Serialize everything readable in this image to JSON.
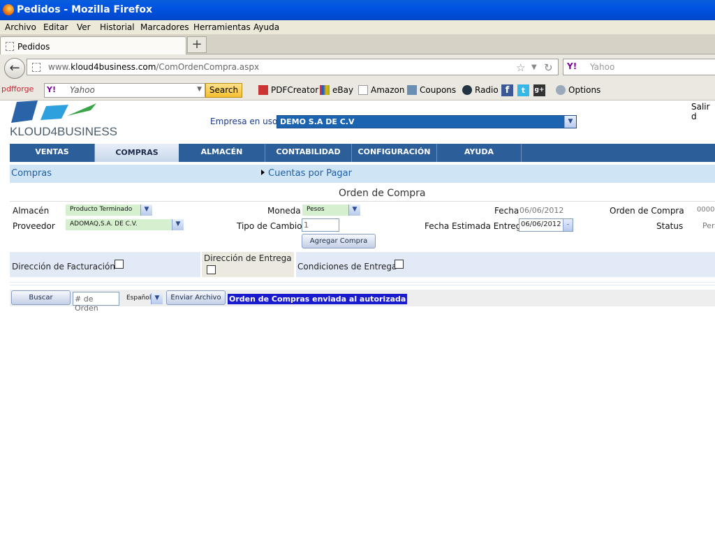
{
  "browser": {
    "title": "Pedidos - Mozilla Firefox",
    "menu": [
      "Archivo",
      "Editar",
      "Ver",
      "Historial",
      "Marcadores",
      "Herramientas",
      "Ayuda"
    ],
    "tab_label": "Pedidos",
    "new_tab": "+",
    "url_prefix": "www.",
    "url_site": "kloud4business.com",
    "url_path": "/ComOrdenCompra.aspx",
    "search_placeholder": "Yahoo",
    "yahoo_logo": "Y!"
  },
  "toolbar": {
    "brand": "pdfforge",
    "search_placeholder": "Yahoo",
    "search_button": "Search",
    "items": [
      "PDFCreator",
      "eBay",
      "Amazon",
      "Coupons",
      "Radio"
    ],
    "options": "Options"
  },
  "app": {
    "logo_text": "KLOUD4BUSINESS",
    "logout": "Salir d",
    "empresa_label": "Empresa en uso:",
    "empresa_value": "DEMO S.A DE C.V",
    "nav": [
      "VENTAS",
      "COMPRAS",
      "ALMACÉN",
      "CONTABILIDAD",
      "CONFIGURACIÓN",
      "AYUDA"
    ],
    "active_nav": "COMPRAS",
    "subnav": {
      "left": "Compras",
      "right": "Cuentas por Pagar"
    },
    "form_title": "Orden de Compra",
    "form": {
      "almacen_label": "Almacén",
      "almacen_value": "Producto Terminado",
      "proveedor_label": "Proveedor",
      "proveedor_value": "ADOMAQ,S.A. DE C.V.",
      "moneda_label": "Moneda",
      "moneda_value": "Pesos",
      "tipo_cambio_label": "Tipo de Cambio",
      "tipo_cambio_value": "1",
      "agregar_compra": "Agregar Compra",
      "fecha_label": "Fecha",
      "fecha_value": "06/06/2012",
      "fecha_estimada_label": "Fecha Estimada Entrega",
      "fecha_estimada_value": "06/06/2012",
      "orden_compra_label": "Orden de Compra",
      "orden_compra_value": "0000",
      "status_label": "Status",
      "status_value": "Per"
    },
    "panels": {
      "facturacion": "Dirección de Facturación",
      "entrega": "Dirección de Entrega",
      "condiciones": "Condiciones de Entrega"
    },
    "bottom": {
      "buscar": "Buscar",
      "orden_placeholder": "# de Orden",
      "idioma": "Español",
      "enviar": "Enviar Archivo",
      "message": "Orden de Compras enviada al autorizada"
    }
  },
  "colors": {
    "nav_bar": "#2c5e9a",
    "subnav": "#cfe4f4",
    "message_bg": "#1a1acf"
  }
}
